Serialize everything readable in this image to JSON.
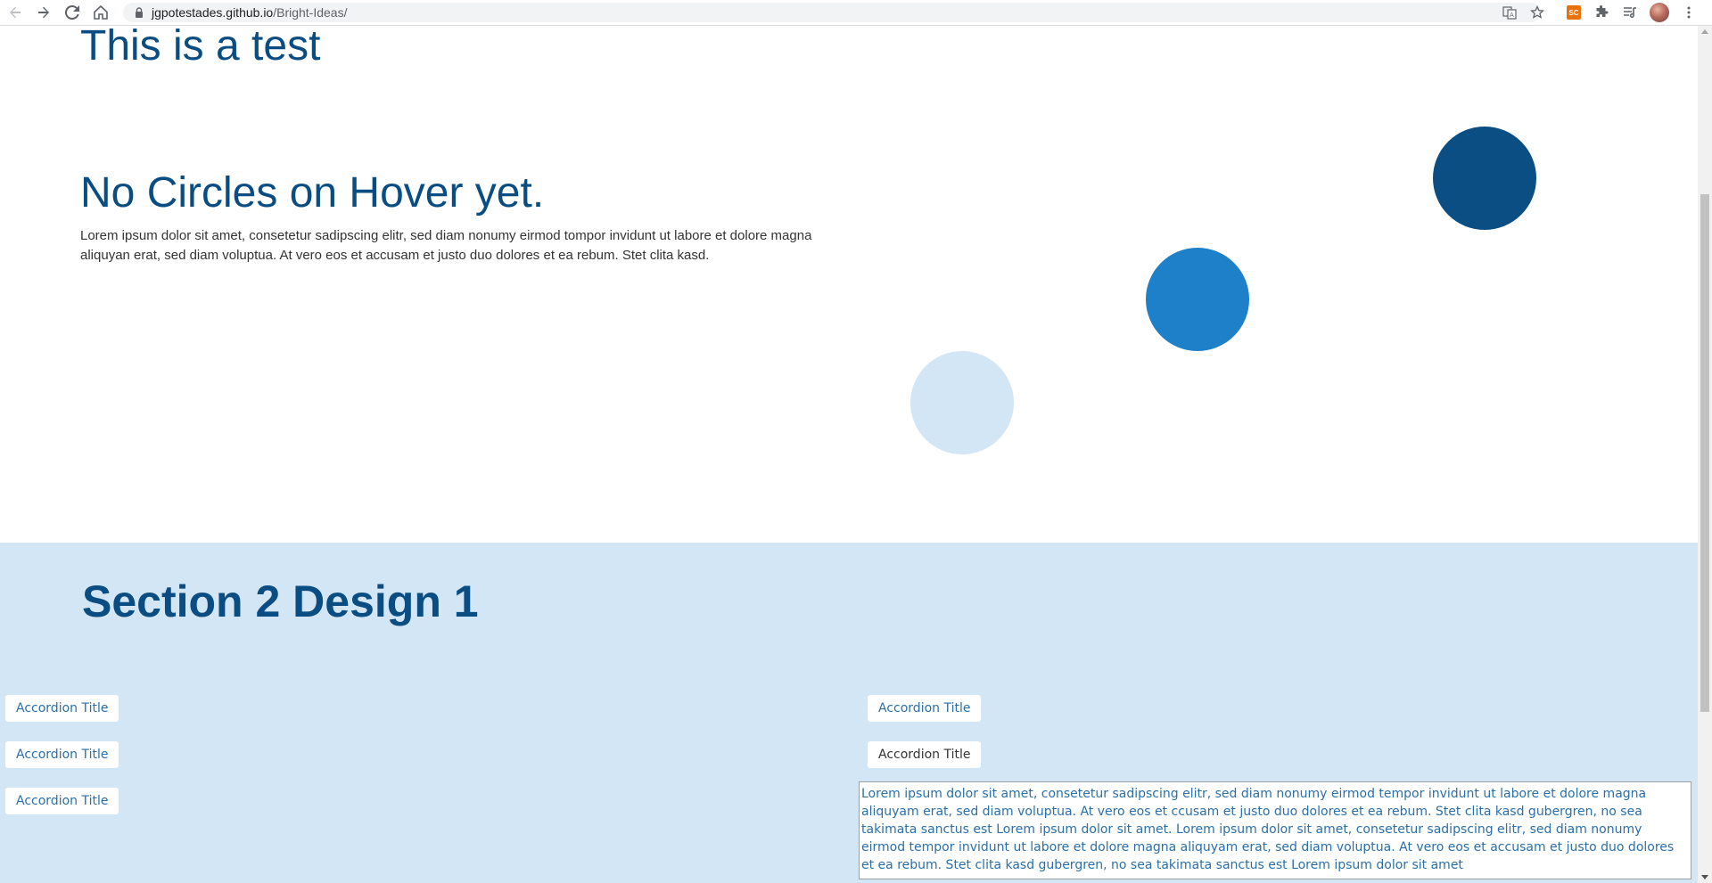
{
  "browser": {
    "url_host": "jgpotestades.github.io",
    "url_path": "/Bright-Ideas/",
    "extension_badge": "SC"
  },
  "hero": {
    "test_heading": "This is a test",
    "circles_heading": "No Circles on Hover yet.",
    "paragraph": "Lorem ipsum dolor sit amet, consetetur sadipscing elitr, sed diam nonumy eirmod tompor invidunt ut labore et dolore magna aliquyan erat, sed diam voluptua. At vero eos et accusam et justo duo dolores et ea rebum. Stet clita kasd."
  },
  "colors": {
    "circle_dark": "#0b4e83",
    "circle_mid": "#1f80ca",
    "circle_light": "#d3e6f6",
    "heading": "#0a4d82",
    "section_bg": "#d3e6f6"
  },
  "section2": {
    "heading": "Section 2 Design 1",
    "accordion_left": [
      {
        "title": "Accordion Title"
      },
      {
        "title": "Accordion Title"
      },
      {
        "title": "Accordion Title"
      }
    ],
    "accordion_right": [
      {
        "title": "Accordion Title",
        "expanded": false
      },
      {
        "title": "Accordion Title",
        "expanded": true
      }
    ],
    "panel_text": "Lorem ipsum dolor sit amet, consetetur sadipscing elitr, sed diam nonumy eirmod tempor invidunt ut labore et dolore magna aliquyam erat, sed diam voluptua. At vero eos et ccusam et justo duo dolores et ea rebum. Stet clita kasd gubergren, no sea takimata sanctus est Lorem ipsum dolor sit amet. Lorem ipsum dolor sit amet, consetetur sadipscing elitr, sed diam nonumy eirmod tempor invidunt ut labore et dolore magna aliquyam erat, sed diam voluptua. At vero eos et accusam et justo duo dolores et ea rebum. Stet clita kasd gubergren, no sea takimata sanctus est Lorem ipsum dolor sit amet"
  }
}
